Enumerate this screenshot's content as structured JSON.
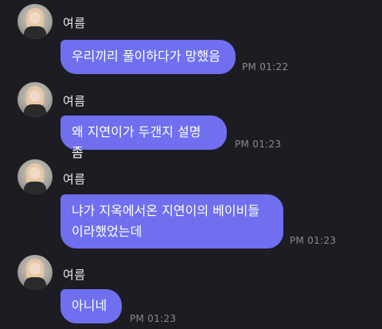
{
  "messages": [
    {
      "sender": "여름",
      "text": "우리끼리 풀이하다가 망했음",
      "time": "PM 01:22"
    },
    {
      "sender": "여름",
      "text": "왜 지연이가 두갠지 설명 좀",
      "time": "PM 01:23"
    },
    {
      "sender": "여름",
      "text": "냐가 지옥에서온 지연이의 베이비들\n이라했었는데",
      "time": "PM 01:23"
    },
    {
      "sender": "여름",
      "text": "아니네",
      "time": "PM 01:23"
    }
  ],
  "colors": {
    "background": "#1d1c22",
    "bubble": "#6f6ff0",
    "time": "#8a8990",
    "name": "#e8e8ec"
  }
}
